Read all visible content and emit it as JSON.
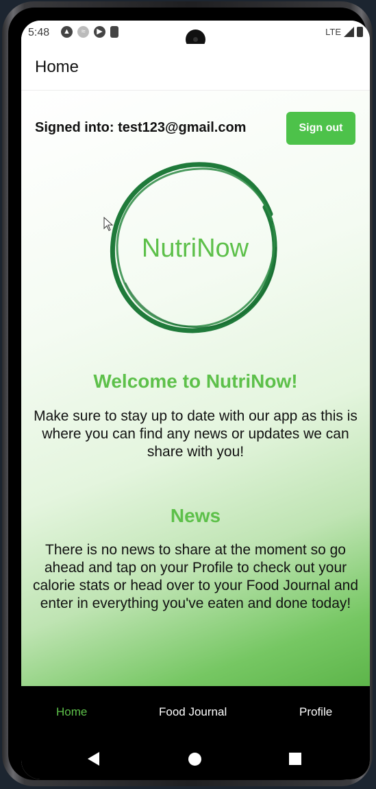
{
  "status": {
    "time": "5:48",
    "network": "LTE",
    "icons": [
      "android-icon",
      "wifi-icon",
      "google-play-icon",
      "sim-card-icon",
      "signal-icon",
      "battery-icon"
    ]
  },
  "appbar": {
    "title": "Home"
  },
  "account": {
    "signed_in_text": "Signed into: test123@gmail.com"
  },
  "signout_label": "Sign out",
  "logo": {
    "text": "NutriNow",
    "color": "#1f7a3a"
  },
  "welcome": {
    "heading": "Welcome to NutriNow!",
    "body": "Make sure to stay up to date with our app as this is where you can find any news or updates we can share with you!"
  },
  "news": {
    "heading": "News",
    "body": "There is no news to share at the moment so go ahead and tap on your Profile to check out your calorie stats or head over to your Food Journal and enter in everything you've eaten and done today!"
  },
  "bottom_nav": {
    "home": "Home",
    "food_journal": "Food Journal",
    "profile": "Profile",
    "active": "home"
  },
  "colors": {
    "accent": "#5dc04a",
    "button": "#4dc24a",
    "nav_bg": "#000000"
  }
}
